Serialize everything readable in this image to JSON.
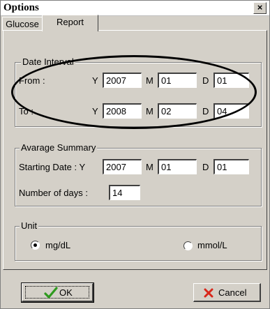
{
  "window": {
    "title": "Options",
    "close_label": "×"
  },
  "tabs": [
    {
      "label": "Glucose"
    },
    {
      "label": "Report"
    }
  ],
  "date_interval": {
    "legend": "Date Interval",
    "from_label": "From :",
    "to_label": "To :",
    "y_label": "Y",
    "m_label": "M",
    "d_label": "D",
    "from": {
      "year": "2007",
      "month": "01",
      "day": "01"
    },
    "to": {
      "year": "2008",
      "month": "02",
      "day": "04"
    }
  },
  "avarage_summary": {
    "legend": "Avarage Summary",
    "starting_label": "Starting Date : Y",
    "m_label": "M",
    "d_label": "D",
    "start": {
      "year": "2007",
      "month": "01",
      "day": "01"
    },
    "days_label": "Number of days :",
    "days_value": "14"
  },
  "unit": {
    "legend": "Unit",
    "options": [
      {
        "label": "mg/dL",
        "selected": true
      },
      {
        "label": "mmol/L",
        "selected": false
      }
    ]
  },
  "buttons": {
    "ok": "OK",
    "cancel": "Cancel"
  },
  "colors": {
    "ok_check": "#2e9a1e",
    "cancel_x": "#d8261a",
    "face": "#d4d0c8"
  }
}
